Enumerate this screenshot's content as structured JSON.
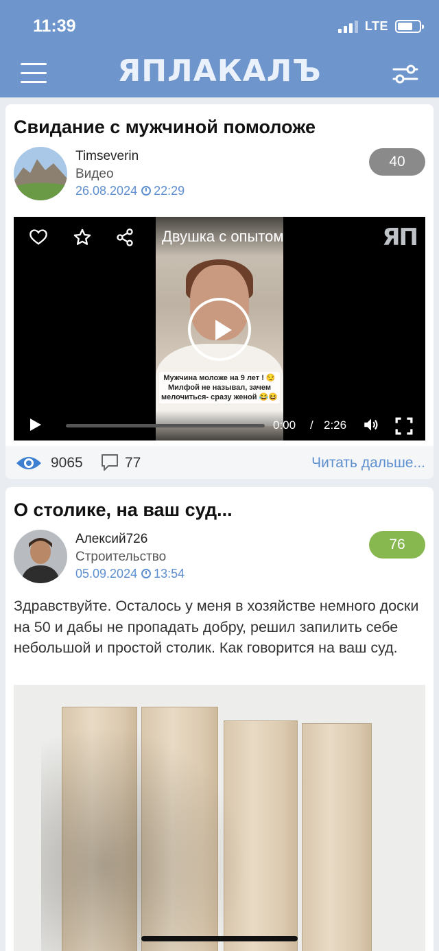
{
  "status_bar": {
    "time": "11:39",
    "network": "LTE",
    "battery_percent": 70
  },
  "header": {
    "logo_text": "ЯПЛАКАЛЪ"
  },
  "posts": [
    {
      "title": "Свидание с мужчиной помоложе",
      "author": "Timseverin",
      "category": "Видео",
      "date": "26.08.2024",
      "time": "22:29",
      "rating": "40",
      "rating_color": "#8a8a8a",
      "video": {
        "title": "Двушка с опытом",
        "logo": "ЯП",
        "caption": "Мужчина моложе на 9 лет ! 😏 Милфой не называл, зачем мелочиться- сразу женой 😂😆",
        "current_time": "0:00",
        "separator": "/",
        "duration": "2:26",
        "progress_fraction": 0
      },
      "views": "9065",
      "comments": "77",
      "read_more": "Читать дальше..."
    },
    {
      "title": "О столике, на ваш суд...",
      "author": "Алексий726",
      "category": "Строительство",
      "date": "05.09.2024",
      "time": "13:54",
      "rating": "76",
      "rating_color": "#86b84f",
      "text": "Здравствуйте. Осталось у меня в хозяйстве немного доски на 50 и дабы не пропадать добру, решил запилить себе небольшой и простой столик. Как говорится на ваш суд."
    }
  ],
  "colors": {
    "header": "#6f96cc",
    "link": "#5e8fcf"
  }
}
